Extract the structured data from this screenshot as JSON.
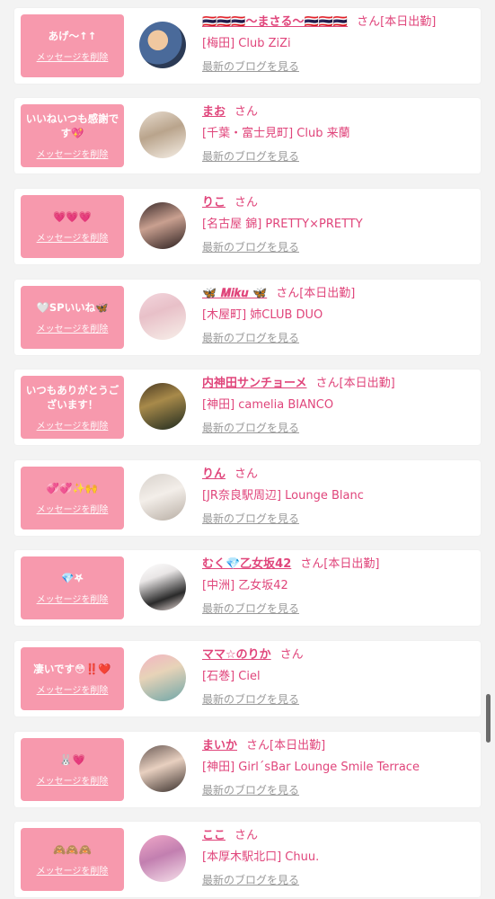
{
  "delete_label": "メッセージを削除",
  "san_label": "さん",
  "blog_label": "最新のブログを見る",
  "items": [
    {
      "message": "あげ〜↑↑",
      "name": "🇹🇭🇹🇭🇹🇭〜まさる〜🇹🇭🇹🇭🇹🇭",
      "tag": "[本日出勤]",
      "shop": "[梅田] Club ZiZi"
    },
    {
      "message": "いいねいつも感謝です💖",
      "name": "まお",
      "tag": "",
      "shop": "[千葉・富士見町] Club 来蘭"
    },
    {
      "message": "💗💗💗",
      "name": "りこ",
      "tag": "",
      "shop": "[名古屋 錦] PRETTY×PRETTY"
    },
    {
      "message": "🤍SPいいね🦋",
      "name": "🦋 𝑴𝒊𝒌𝒖 🦋",
      "tag": "[本日出勤]",
      "shop": "[木屋町] 姉CLUB DUO"
    },
    {
      "message": "いつもありがとうございます！",
      "name": "内神田サンチョーメ",
      "tag": "[本日出勤]",
      "shop": "[神田] camelia BIANCO"
    },
    {
      "message": "💞💞✨🙌",
      "name": "りん",
      "tag": "",
      "shop": "[JR奈良駅周辺] Lounge Blanc"
    },
    {
      "message": "💎𖤐",
      "name": "むく💎乙女坂42",
      "tag": "[本日出勤]",
      "shop": "[中洲] 乙女坂42"
    },
    {
      "message": "凄いです😳‼️❤️",
      "name": "ママ☆のりか",
      "tag": "",
      "shop": "[石巻] Ciel"
    },
    {
      "message": "🐰💗",
      "name": "まいか",
      "tag": "[本日出勤]",
      "shop": "[神田] Girl´sBar Lounge Smile Terrace"
    },
    {
      "message": "🙈🙈🙈",
      "name": "ここ",
      "tag": "",
      "shop": "[本厚木駅北口] Chuu."
    }
  ]
}
